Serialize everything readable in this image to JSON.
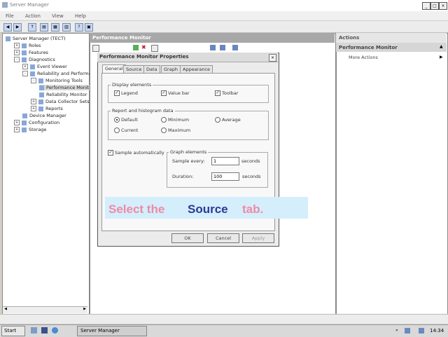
{
  "window": {
    "title": "Server Manager"
  },
  "menu": [
    "File",
    "Action",
    "View",
    "Help"
  ],
  "tree": [
    {
      "label": "Server Manager (TECT)",
      "indent": 0,
      "exp": ""
    },
    {
      "label": "Roles",
      "indent": 1,
      "exp": "+"
    },
    {
      "label": "Features",
      "indent": 1,
      "exp": "+"
    },
    {
      "label": "Diagnostics",
      "indent": 1,
      "exp": "-"
    },
    {
      "label": "Event Viewer",
      "indent": 2,
      "exp": "+"
    },
    {
      "label": "Reliability and Performance",
      "indent": 2,
      "exp": "-"
    },
    {
      "label": "Monitoring Tools",
      "indent": 3,
      "exp": "-"
    },
    {
      "label": "Performance Monitor",
      "indent": 4,
      "exp": "",
      "selected": true
    },
    {
      "label": "Reliability Monitor",
      "indent": 4,
      "exp": ""
    },
    {
      "label": "Data Collector Sets",
      "indent": 3,
      "exp": "+"
    },
    {
      "label": "Reports",
      "indent": 3,
      "exp": "+"
    },
    {
      "label": "Device Manager",
      "indent": 2,
      "exp": ""
    },
    {
      "label": "Configuration",
      "indent": 1,
      "exp": "+"
    },
    {
      "label": "Storage",
      "indent": 1,
      "exp": "+"
    }
  ],
  "center": {
    "title": "Performance Monitor"
  },
  "actions": {
    "title": "Actions",
    "section": "Performance Monitor",
    "more": "More Actions"
  },
  "dialog": {
    "title": "Performance Monitor Properties",
    "tabs": [
      "General",
      "Source",
      "Data",
      "Graph",
      "Appearance"
    ],
    "display_elements": {
      "label": "Display elements",
      "items": [
        {
          "label": "Legend",
          "checked": true
        },
        {
          "label": "Value bar",
          "checked": true
        },
        {
          "label": "Toolbar",
          "checked": true
        }
      ]
    },
    "report": {
      "label": "Report and histogram data",
      "options": [
        "Default",
        "Minimum",
        "Average",
        "Current",
        "Maximum"
      ],
      "selected": "Default"
    },
    "sample_auto": {
      "label": "Sample automatically",
      "checked": true
    },
    "graph_elements": {
      "label": "Graph elements",
      "sample_every_label": "Sample every:",
      "sample_every_value": "1",
      "sample_every_unit": "seconds",
      "duration_label": "Duration:",
      "duration_value": "100",
      "duration_unit": "seconds"
    },
    "buttons": {
      "ok": "OK",
      "cancel": "Cancel",
      "apply": "Apply"
    }
  },
  "banner": {
    "part1": "Select the",
    "part2": "Source",
    "part3": "tab."
  },
  "taskbar": {
    "start": "Start",
    "task": "Server Manager",
    "clock": "14:34"
  },
  "colors": {
    "banner_pink": "#ef8aa3",
    "banner_navy": "#2b3a93",
    "banner_bg": "#d4eefc"
  }
}
